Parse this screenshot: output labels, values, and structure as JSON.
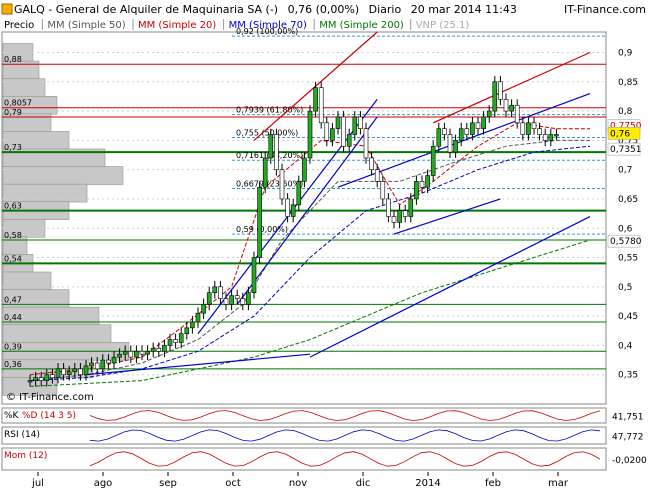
{
  "header": {
    "icon": "square-logo-icon",
    "title": "GALQ - General de Alquiler de Maquinaria SA (-)",
    "price_info": "0,76 (0,00%)",
    "period": "Diario",
    "datetime": "20 mar 2014 11:43",
    "brand": "IT-Finance.com"
  },
  "legend": [
    {
      "label": "Precio",
      "color": "#000000"
    },
    {
      "label": "MM (Simple 50)",
      "color": "#555555"
    },
    {
      "label": "MM (Simple 20)",
      "color": "#cc0000"
    },
    {
      "label": "MM (Simple 70)",
      "color": "#0000cc"
    },
    {
      "label": "MM (Simple 200)",
      "color": "#007700"
    },
    {
      "label": "VNP (25.1)",
      "color": "#aaaaaa"
    }
  ],
  "watermark": "© IT-Finance.com",
  "chart_data": {
    "type": "candlestick",
    "x_tick_labels": [
      "jul",
      "ago",
      "sep",
      "oct",
      "nov",
      "dic",
      "2014",
      "feb",
      "mar"
    ],
    "y_ticks": [
      "0,9",
      "0,85",
      "0,8",
      "0,75",
      "0,7",
      "0,65",
      "0,6",
      "0,55",
      "0,5",
      "0,45",
      "0,4",
      "0,35"
    ],
    "ylim": [
      0.3,
      0.935
    ],
    "price_badges": [
      {
        "label": "0,7750",
        "value": 0.775,
        "color": "#cc0000",
        "fill": "#ffffff"
      },
      {
        "label": "0,76",
        "value": 0.762,
        "color": "#000000",
        "fill": "#ffee00"
      },
      {
        "label": "0,7351",
        "value": 0.7351,
        "color": "#000000",
        "fill": "#ffffff"
      },
      {
        "label": "0,5780",
        "value": 0.578,
        "color": "#000000",
        "fill": "#ffffff"
      }
    ],
    "fibonacci": [
      {
        "label": "0,92 (100,00%)",
        "value": 0.928
      },
      {
        "label": "0,7939 (61,80%)",
        "value": 0.7939
      },
      {
        "label": "0,755 (50,00%)",
        "value": 0.755
      },
      {
        "label": "0,7161 (38,20%)",
        "value": 0.7161
      },
      {
        "label": "0,6679 (23,60%)",
        "value": 0.6679
      },
      {
        "label": "0,59 (0,00%)",
        "value": 0.59
      }
    ],
    "horizontal_levels": [
      {
        "label": "0,88",
        "value": 0.88,
        "color": "#cc0000",
        "width": 1
      },
      {
        "label": "0,8057",
        "value": 0.8057,
        "color": "#cc0000",
        "width": 1
      },
      {
        "label": "0,79",
        "value": 0.79,
        "color": "#cc0000",
        "width": 1
      },
      {
        "label": "0,73",
        "value": 0.73,
        "color": "#007700",
        "width": 2
      },
      {
        "label": "0,63",
        "value": 0.63,
        "color": "#007700",
        "width": 2
      },
      {
        "label": "0,58",
        "value": 0.58,
        "color": "#007700",
        "width": 1
      },
      {
        "label": "0,54",
        "value": 0.54,
        "color": "#007700",
        "width": 2
      },
      {
        "label": "0,47",
        "value": 0.47,
        "color": "#007700",
        "width": 1
      },
      {
        "label": "0,44",
        "value": 0.44,
        "color": "#007700",
        "width": 1
      },
      {
        "label": "0,39",
        "value": 0.39,
        "color": "#007700",
        "width": 1
      },
      {
        "label": "0,36",
        "value": 0.36,
        "color": "#007700",
        "width": 1
      }
    ],
    "volume_profile": [
      {
        "price": 0.9,
        "length": 0.25
      },
      {
        "price": 0.87,
        "length": 0.3
      },
      {
        "price": 0.84,
        "length": 0.35
      },
      {
        "price": 0.81,
        "length": 0.45
      },
      {
        "price": 0.78,
        "length": 0.4
      },
      {
        "price": 0.75,
        "length": 0.55
      },
      {
        "price": 0.72,
        "length": 0.85
      },
      {
        "price": 0.69,
        "length": 1.0
      },
      {
        "price": 0.66,
        "length": 0.7
      },
      {
        "price": 0.63,
        "length": 0.55
      },
      {
        "price": 0.6,
        "length": 0.35
      },
      {
        "price": 0.57,
        "length": 0.2
      },
      {
        "price": 0.54,
        "length": 0.25
      },
      {
        "price": 0.51,
        "length": 0.4
      },
      {
        "price": 0.48,
        "length": 0.55
      },
      {
        "price": 0.45,
        "length": 0.8
      },
      {
        "price": 0.42,
        "length": 0.9
      },
      {
        "price": 0.39,
        "length": 1.05
      },
      {
        "price": 0.36,
        "length": 0.75
      },
      {
        "price": 0.33,
        "length": 0.45
      }
    ],
    "series": [
      {
        "name": "MM (Simple 20)",
        "color": "#cc0000",
        "dash": "4,2",
        "points": [
          [
            0,
            0.35
          ],
          [
            0.1,
            0.36
          ],
          [
            0.2,
            0.38
          ],
          [
            0.27,
            0.43
          ],
          [
            0.36,
            0.5
          ],
          [
            0.42,
            0.67
          ],
          [
            0.52,
            0.75
          ],
          [
            0.6,
            0.74
          ],
          [
            0.66,
            0.64
          ],
          [
            0.72,
            0.68
          ],
          [
            0.8,
            0.74
          ],
          [
            0.87,
            0.78
          ],
          [
            0.94,
            0.77
          ],
          [
            1,
            0.77
          ]
        ]
      },
      {
        "name": "MM (Simple 50)",
        "color": "#555555",
        "dash": "4,2",
        "points": [
          [
            0,
            0.34
          ],
          [
            0.1,
            0.35
          ],
          [
            0.2,
            0.37
          ],
          [
            0.3,
            0.41
          ],
          [
            0.38,
            0.47
          ],
          [
            0.45,
            0.58
          ],
          [
            0.55,
            0.68
          ],
          [
            0.66,
            0.68
          ],
          [
            0.75,
            0.71
          ],
          [
            0.85,
            0.74
          ],
          [
            0.94,
            0.75
          ],
          [
            1,
            0.75
          ]
        ]
      },
      {
        "name": "MM (Simple 70)",
        "color": "#0000cc",
        "dash": "4,2",
        "points": [
          [
            0,
            0.34
          ],
          [
            0.1,
            0.345
          ],
          [
            0.2,
            0.36
          ],
          [
            0.3,
            0.39
          ],
          [
            0.4,
            0.45
          ],
          [
            0.5,
            0.55
          ],
          [
            0.6,
            0.63
          ],
          [
            0.7,
            0.66
          ],
          [
            0.8,
            0.7
          ],
          [
            0.9,
            0.73
          ],
          [
            1,
            0.74
          ]
        ]
      },
      {
        "name": "MM (Simple 200)",
        "color": "#007700",
        "dash": "4,2",
        "points": [
          [
            0,
            0.33
          ],
          [
            0.1,
            0.335
          ],
          [
            0.2,
            0.34
          ],
          [
            0.3,
            0.36
          ],
          [
            0.4,
            0.38
          ],
          [
            0.5,
            0.41
          ],
          [
            0.6,
            0.45
          ],
          [
            0.7,
            0.49
          ],
          [
            0.8,
            0.52
          ],
          [
            0.9,
            0.55
          ],
          [
            1,
            0.58
          ]
        ]
      }
    ],
    "trendlines": [
      {
        "color": "#cc0000",
        "points": [
          [
            0.4,
            0.75
          ],
          [
            0.62,
            0.935
          ]
        ]
      },
      {
        "color": "#cc0000",
        "points": [
          [
            0.72,
            0.78
          ],
          [
            1,
            0.9
          ]
        ]
      },
      {
        "color": "#0000cc",
        "points": [
          [
            0.3,
            0.42
          ],
          [
            0.62,
            0.82
          ]
        ]
      },
      {
        "color": "#0000cc",
        "points": [
          [
            0.37,
            0.47
          ],
          [
            0.62,
            0.79
          ]
        ]
      },
      {
        "color": "#0000cc",
        "points": [
          [
            0.55,
            0.67
          ],
          [
            1,
            0.83
          ]
        ]
      },
      {
        "color": "#0000cc",
        "points": [
          [
            0.5,
            0.38
          ],
          [
            1,
            0.62
          ]
        ]
      },
      {
        "color": "#0000cc",
        "points": [
          [
            0.1,
            0.35
          ],
          [
            0.5,
            0.385
          ]
        ]
      },
      {
        "color": "#0000cc",
        "points": [
          [
            0.65,
            0.59
          ],
          [
            0.84,
            0.65
          ]
        ]
      }
    ],
    "candles": [
      [
        0,
        0.34
      ],
      [
        0.01,
        0.345
      ],
      [
        0.02,
        0.34
      ],
      [
        0.03,
        0.35
      ],
      [
        0.04,
        0.345
      ],
      [
        0.05,
        0.36
      ],
      [
        0.06,
        0.35
      ],
      [
        0.07,
        0.355
      ],
      [
        0.08,
        0.36
      ],
      [
        0.09,
        0.35
      ],
      [
        0.1,
        0.365
      ],
      [
        0.11,
        0.37
      ],
      [
        0.12,
        0.36
      ],
      [
        0.13,
        0.375
      ],
      [
        0.14,
        0.37
      ],
      [
        0.15,
        0.38
      ],
      [
        0.16,
        0.385
      ],
      [
        0.17,
        0.39
      ],
      [
        0.18,
        0.38
      ],
      [
        0.19,
        0.39
      ],
      [
        0.2,
        0.385
      ],
      [
        0.21,
        0.39
      ],
      [
        0.22,
        0.395
      ],
      [
        0.23,
        0.39
      ],
      [
        0.24,
        0.4
      ],
      [
        0.25,
        0.41
      ],
      [
        0.26,
        0.405
      ],
      [
        0.27,
        0.42
      ],
      [
        0.28,
        0.43
      ],
      [
        0.29,
        0.44
      ],
      [
        0.3,
        0.455
      ],
      [
        0.31,
        0.47
      ],
      [
        0.32,
        0.49
      ],
      [
        0.33,
        0.5
      ],
      [
        0.34,
        0.48
      ],
      [
        0.35,
        0.47
      ],
      [
        0.36,
        0.485
      ],
      [
        0.37,
        0.48
      ],
      [
        0.38,
        0.47
      ],
      [
        0.39,
        0.49
      ],
      [
        0.4,
        0.55
      ],
      [
        0.41,
        0.67
      ],
      [
        0.42,
        0.72
      ],
      [
        0.43,
        0.76
      ],
      [
        0.44,
        0.7
      ],
      [
        0.45,
        0.65
      ],
      [
        0.46,
        0.62
      ],
      [
        0.47,
        0.64
      ],
      [
        0.48,
        0.68
      ],
      [
        0.49,
        0.72
      ],
      [
        0.5,
        0.8
      ],
      [
        0.51,
        0.84
      ],
      [
        0.52,
        0.78
      ],
      [
        0.53,
        0.75
      ],
      [
        0.54,
        0.77
      ],
      [
        0.55,
        0.79
      ],
      [
        0.56,
        0.74
      ],
      [
        0.57,
        0.76
      ],
      [
        0.58,
        0.79
      ],
      [
        0.59,
        0.77
      ],
      [
        0.6,
        0.72
      ],
      [
        0.61,
        0.7
      ],
      [
        0.62,
        0.68
      ],
      [
        0.63,
        0.65
      ],
      [
        0.64,
        0.62
      ],
      [
        0.65,
        0.61
      ],
      [
        0.66,
        0.63
      ],
      [
        0.67,
        0.62
      ],
      [
        0.68,
        0.65
      ],
      [
        0.69,
        0.68
      ],
      [
        0.7,
        0.67
      ],
      [
        0.71,
        0.69
      ],
      [
        0.72,
        0.74
      ],
      [
        0.73,
        0.77
      ],
      [
        0.74,
        0.76
      ],
      [
        0.75,
        0.73
      ],
      [
        0.76,
        0.75
      ],
      [
        0.77,
        0.77
      ],
      [
        0.78,
        0.76
      ],
      [
        0.79,
        0.78
      ],
      [
        0.8,
        0.77
      ],
      [
        0.81,
        0.79
      ],
      [
        0.82,
        0.8
      ],
      [
        0.83,
        0.85
      ],
      [
        0.84,
        0.82
      ],
      [
        0.85,
        0.8
      ],
      [
        0.86,
        0.81
      ],
      [
        0.87,
        0.78
      ],
      [
        0.88,
        0.76
      ],
      [
        0.89,
        0.78
      ],
      [
        0.9,
        0.77
      ],
      [
        0.91,
        0.76
      ],
      [
        0.92,
        0.75
      ],
      [
        0.93,
        0.76
      ],
      [
        0.94,
        0.76
      ]
    ]
  },
  "indicators": [
    {
      "label": "%K",
      "sublabel": "%D (14 3 5)",
      "value": "41,751",
      "ticks": [
        "80",
        "20"
      ],
      "color": "#cc0000"
    },
    {
      "label": "RSI (14)",
      "value": "47,772",
      "ticks": [
        "70",
        "30"
      ],
      "color": "#0000cc"
    },
    {
      "label": "Mom (12)",
      "value": "-0,0200",
      "ticks": [
        "0"
      ],
      "color": "#cc0000"
    }
  ]
}
